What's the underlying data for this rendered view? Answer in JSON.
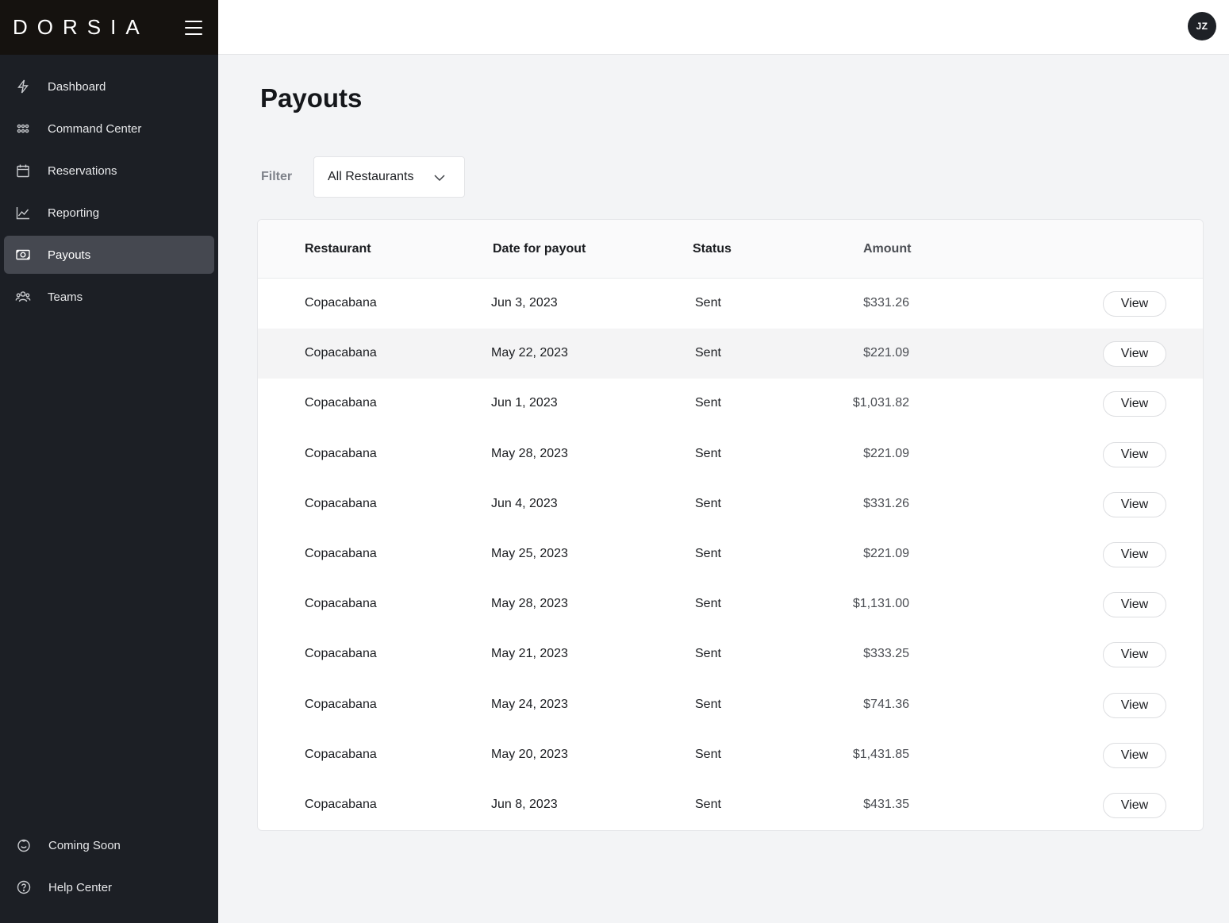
{
  "brand": {
    "name": "DORSIA"
  },
  "sidebar": {
    "items": [
      {
        "label": "Dashboard",
        "icon": "bolt-icon"
      },
      {
        "label": "Command Center",
        "icon": "grid-icon"
      },
      {
        "label": "Reservations",
        "icon": "calendar-icon"
      },
      {
        "label": "Reporting",
        "icon": "chart-line-icon"
      },
      {
        "label": "Payouts",
        "icon": "cash-icon",
        "active": true
      },
      {
        "label": "Teams",
        "icon": "users-icon"
      }
    ],
    "bottom_items": [
      {
        "label": "Coming Soon",
        "icon": "smile-icon"
      },
      {
        "label": "Help Center",
        "icon": "help-circle-icon"
      }
    ]
  },
  "user": {
    "initials": "JZ"
  },
  "page": {
    "title": "Payouts"
  },
  "filter": {
    "label": "Filter",
    "value": "All Restaurants"
  },
  "table": {
    "columns": {
      "restaurant": "Restaurant",
      "date": "Date for payout",
      "status": "Status",
      "amount": "Amount"
    },
    "rows": [
      {
        "restaurant": "Copacabana",
        "date": "Jun 3, 2023",
        "status": "Sent",
        "amount": "$331.26",
        "action": "View"
      },
      {
        "restaurant": "Copacabana",
        "date": "May 22, 2023",
        "status": "Sent",
        "amount": "$221.09",
        "action": "View"
      },
      {
        "restaurant": "Copacabana",
        "date": "Jun 1, 2023",
        "status": "Sent",
        "amount": "$1,031.82",
        "action": "View"
      },
      {
        "restaurant": "Copacabana",
        "date": "May 28, 2023",
        "status": "Sent",
        "amount": "$221.09",
        "action": "View"
      },
      {
        "restaurant": "Copacabana",
        "date": "Jun 4, 2023",
        "status": "Sent",
        "amount": "$331.26",
        "action": "View"
      },
      {
        "restaurant": "Copacabana",
        "date": "May 25, 2023",
        "status": "Sent",
        "amount": "$221.09",
        "action": "View"
      },
      {
        "restaurant": "Copacabana",
        "date": "May 28, 2023",
        "status": "Sent",
        "amount": "$1,131.00",
        "action": "View"
      },
      {
        "restaurant": "Copacabana",
        "date": "May 21, 2023",
        "status": "Sent",
        "amount": "$333.25",
        "action": "View"
      },
      {
        "restaurant": "Copacabana",
        "date": "May 24, 2023",
        "status": "Sent",
        "amount": "$741.36",
        "action": "View"
      },
      {
        "restaurant": "Copacabana",
        "date": "May 20, 2023",
        "status": "Sent",
        "amount": "$1,431.85",
        "action": "View"
      },
      {
        "restaurant": "Copacabana",
        "date": "Jun 8, 2023",
        "status": "Sent",
        "amount": "$431.35",
        "action": "View"
      }
    ]
  }
}
